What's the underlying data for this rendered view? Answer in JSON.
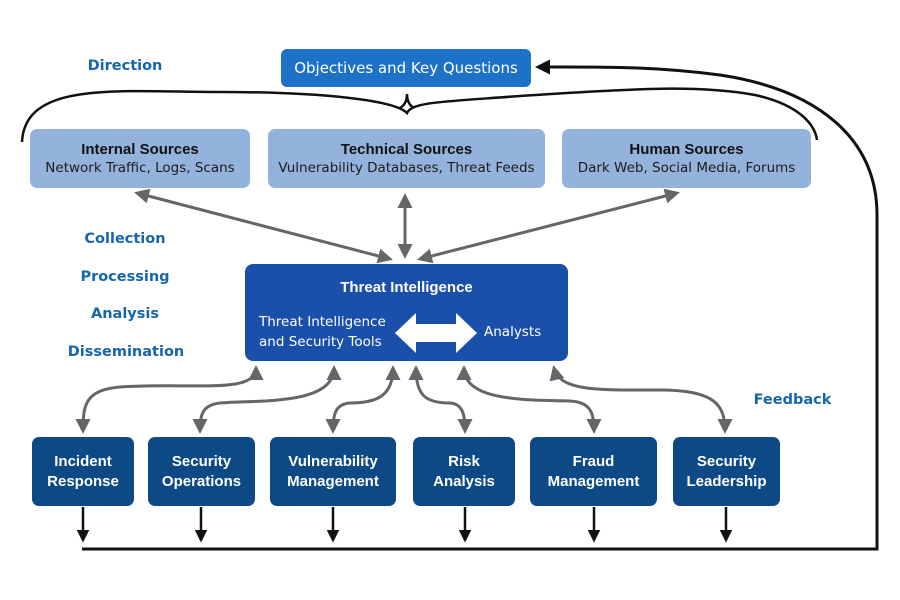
{
  "diagram": {
    "objective": {
      "label": "Objectives and Key Questions"
    },
    "stages": {
      "direction": "Direction",
      "collection": "Collection",
      "processing": "Processing",
      "analysis": "Analysis",
      "dissemination": "Dissemination",
      "feedback": "Feedback"
    },
    "sources": [
      {
        "title": "Internal Sources",
        "desc": "Network Traffic, Logs, Scans"
      },
      {
        "title": "Technical Sources",
        "desc": "Vulnerability Databases, Threat Feeds"
      },
      {
        "title": "Human Sources",
        "desc": "Dark Web, Social Media, Forums"
      }
    ],
    "core": {
      "title": "Threat Intelligence",
      "left_line1": "Threat Intelligence",
      "left_line2": "and Security Tools",
      "right": "Analysts",
      "connector_icon": "double-headed-arrow-icon"
    },
    "consumers": [
      {
        "line1": "Incident",
        "line2": "Response"
      },
      {
        "line1": "Security",
        "line2": "Operations"
      },
      {
        "line1": "Vulnerability",
        "line2": "Management"
      },
      {
        "line1": "Risk",
        "line2": "Analysis"
      },
      {
        "line1": "Fraud",
        "line2": "Management"
      },
      {
        "line1": "Security",
        "line2": "Leadership"
      }
    ],
    "colors": {
      "objective": "#1d72c8",
      "source": "#93b3dc",
      "core": "#1a50aa",
      "consumer": "#0d4a85",
      "stage_text": "#1666ae",
      "gray_arrow": "#666666",
      "black_line": "#111111"
    }
  }
}
